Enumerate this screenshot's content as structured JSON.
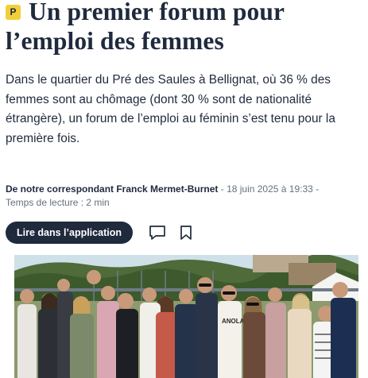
{
  "article": {
    "premium_badge": "P",
    "headline": "Un premier forum pour l’emploi des femmes",
    "lead": "Dans le quartier du Pré des Saules à Bellignat, où 36 % des femmes sont au chômage (dont 30 % sont de nationalité étrangère), un forum de l’emploi au féminin s’est tenu pour la première fois.",
    "byline": {
      "author": "De notre correspondant Franck Mermet-Burnet",
      "separator": " - ",
      "date": "18 juin 2025 à 19:33",
      "separator2": " - ",
      "reading_time": "Temps de lecture : 2 min"
    },
    "actions": {
      "app_button_label": "Lire dans l’application",
      "comment_icon": "comment-icon",
      "bookmark_icon": "bookmark-icon"
    },
    "photo": {
      "description_icon": "group-photo",
      "tshirt_text": "ANOLA"
    }
  },
  "colors": {
    "text": "#1f2a3d",
    "muted": "#66707e",
    "badge": "#f2cf3a",
    "button": "#1f2a3d"
  }
}
